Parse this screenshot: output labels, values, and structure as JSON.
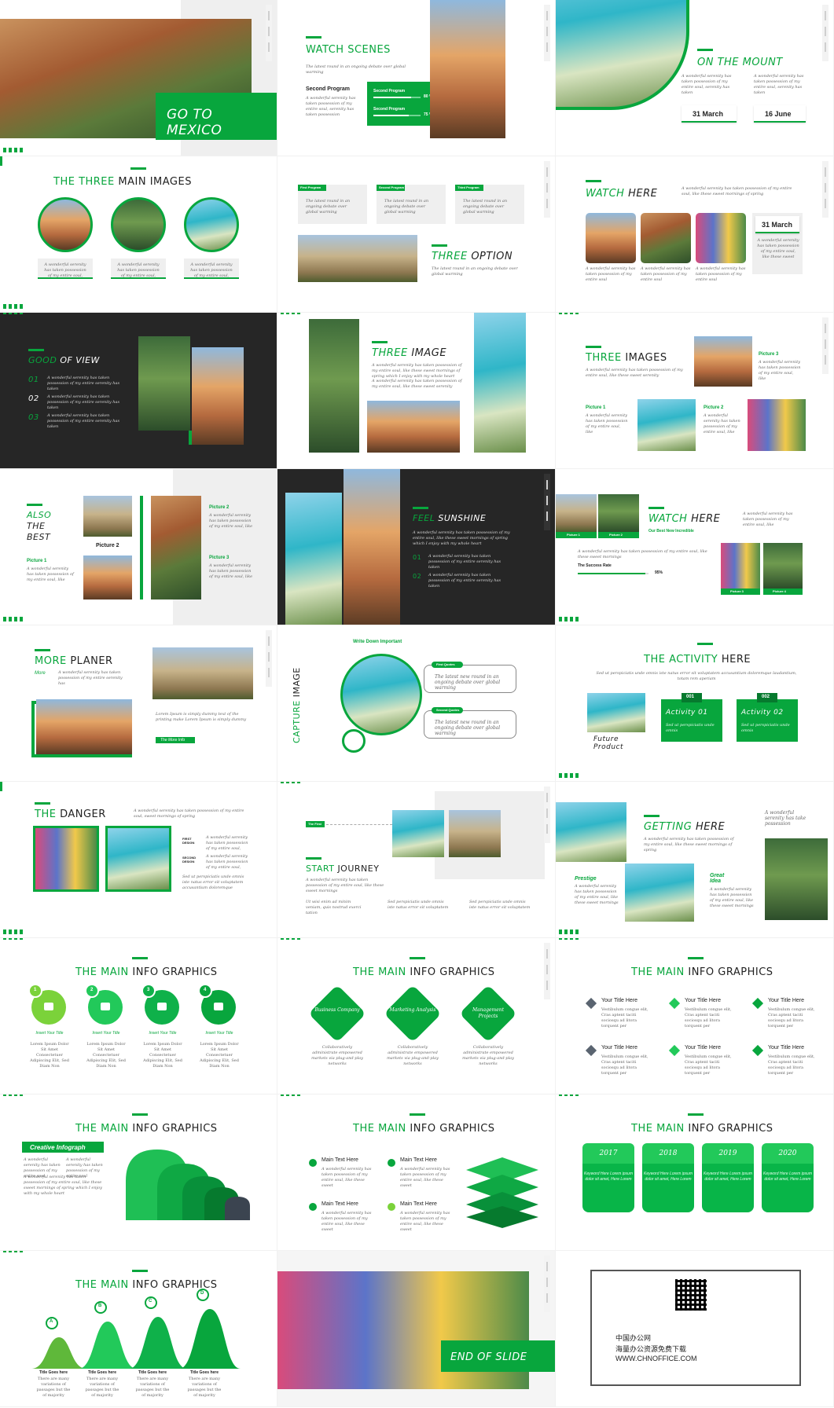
{
  "slides": {
    "s1": {
      "title": "GO TO MEXICO"
    },
    "s2": {
      "title_plain": "WATCH",
      "title_accent": "SCENES",
      "intro": "The latest round in an ongoing debate over global warming",
      "subhead": "Second Program",
      "body": "A wonderful serenity has taken possession of my entire soul, serenity has taken possession",
      "bar1_label": "Second Program",
      "bar1_value": "80 %",
      "bar1_fraction": 0.8,
      "bar2_label": "Second Program",
      "bar2_value": "75 %",
      "bar2_fraction": 0.75
    },
    "s3": {
      "title_plain": "ON THE",
      "title_accent": "MOUNT",
      "text1": "A wonderful serenity has taken possession of my entire soul, serenity has taken",
      "text2": "A wonderful serenity has taken possession of my entire soul, serenity has taken",
      "date1": "31 March",
      "date2": "16 June"
    },
    "s4": {
      "title_accent": "THE THREE",
      "title_plain": "MAIN IMAGES",
      "caption1": "A wonderful serenity has taken possession of my entire soul,",
      "caption2": "A wonderful serenity has taken possession of my entire soul,",
      "caption3": "A wonderful serenity has taken possession of my entire soul,"
    },
    "s5": {
      "tab1": "First Program",
      "tab2": "Second Program",
      "tab3": "Third Program",
      "text1": "The latest round in an ongoing debate over global warming",
      "text2": "The latest round in an ongoing debate over global warming",
      "text3": "The latest round in an ongoing debate over global warming",
      "title_accent": "THREE",
      "title_plain": "OPTION",
      "body": "The latest round in an ongoing debate over global warming"
    },
    "s6": {
      "title_accent": "WATCH",
      "title_plain": "HERE",
      "intro": "A wonderful serenity has taken possession of my entire soul, like these sweet mornings of spring",
      "date": "31 March",
      "date_text": "A wonderful serenity has taken possession of my entire soul, like these sweet",
      "cap1": "A wonderful serenity has taken possession of my entire soul",
      "cap2": "A wonderful serenity has taken possession of my entire soul",
      "cap3": "A wonderful serenity has taken possession of my entire soul"
    },
    "s7": {
      "title_accent": "GOOD",
      "title_plain": "OF VIEW",
      "n1": "01",
      "n2": "02",
      "n3": "03",
      "t1": "A wonderful serenity has taken possession of my entire serenity has taken",
      "t2": "A wonderful serenity has taken possession of my entire serenity has taken",
      "t3": "A wonderful serenity has taken possession of my entire serenity has taken"
    },
    "s8": {
      "title_accent": "THREE",
      "title_plain": "IMAGE",
      "body": "A wonderful serenity has taken possession of my entire soul, like these sweet mornings of spring which I enjoy with my whole heart",
      "body2": "A wonderful serenity has taken possession of my entire soul, like these sweet serenity"
    },
    "s9": {
      "title_accent": "THREE",
      "title_plain": "IMAGES",
      "body": "A wonderful serenity has taken possession of my entire soul, like these sweet serenity",
      "p1": "Picture 1",
      "p1_text": "A wonderful serenity has taken possession of my entire soul, like",
      "p2": "Picture 2",
      "p2_text": "A wonderful serenity has taken possession of my entire soul, like",
      "p3": "Picture 3",
      "p3_text": "A wonderful serenity has taken possession of my entire soul, like"
    },
    "s10": {
      "line1": "ALSO",
      "line2": "THE",
      "line3": "BEST",
      "p1": "Picture 1",
      "p1_text": "A wonderful serenity has taken possession of my entire soul, like",
      "p2": "Picture 2",
      "p2_center": "Picture 2",
      "p2_text": "A wonderful serenity has taken possession of my entire soul, like",
      "p3": "Picture 3",
      "p3_text": "A wonderful serenity has taken possession of my entire soul, like"
    },
    "s11": {
      "title_accent": "FEEL",
      "title_plain": "SUNSHINE",
      "body": "A wonderful serenity has taken possession of my entire soul, like these sweet mornings of spring which I enjoy with my whole heart",
      "n1": "01",
      "t1": "A wonderful serenity has taken possession of my entire serenity has taken",
      "n2": "02",
      "t2": "A wonderful serenity has taken possession of my entire serenity has taken"
    },
    "s12": {
      "title_accent": "WATCH",
      "title_plain": "HERE",
      "subtitle": "Our Best New Incredible",
      "side": "A wonderful serenity has taken possession of my entire soul, like",
      "body": "A wonderful serenity has taken possession of my entire soul, like these sweet mornings",
      "rate_label": "The Success Rate",
      "rate_value": "95%",
      "rate_fraction": 0.95,
      "pic1": "Picture 1",
      "pic2": "Picture 2",
      "pic3": "Picture 3",
      "pic4": "Picture 4"
    },
    "s13": {
      "title_accent": "MORE",
      "title_plain": "PLANER",
      "more": "More",
      "more_text": "A wonderful serenity has taken possession of my entire serenity has",
      "lorem": "Lorem Ipsum is simply dummy text of the printing make Lorem Ipsum is simply dummy",
      "button": "The More Info"
    },
    "s14": {
      "header": "Write Down Important",
      "vertical_accent": "CAPTURE",
      "vertical_plain": "IMAGE",
      "q1_label": "First Quotes",
      "q1": "The latest new round in an ongoing debate over global warming",
      "q2_label": "Second Quotes",
      "q2": "The latest new round in an ongoing debate over global warming"
    },
    "s15": {
      "title_plain": "THE",
      "title_accent": "ACTIVITY",
      "title_end": "HERE",
      "intro": "Sed ut perspiciatis unde omnis iste natus error sit voluptatem accusantium doloremque laudantium, totam rem aperiam",
      "future": "Future Product",
      "a1_num": "001",
      "a1": "Activity 01",
      "a1_text": "Sed ut perspiciatis unde omnis",
      "a2_num": "002",
      "a2": "Activity 02",
      "a2_text": "Sed ut perspiciatis unde omnis"
    },
    "s16": {
      "title_accent": "THE",
      "title_plain": "DANGER",
      "intro": "A wonderful serenity has taken possession of my entire soul, sweet mornings of spring",
      "first": "FIRST DESIGN",
      "first_text": "A wonderful serenity has taken possession of my entire soul,",
      "second": "SECOND DESIGN",
      "second_text": "A wonderful serenity has taken possession of my entire soul,",
      "bottom": "Sed ut perspiciatis unde omnis iste natus error sit voluptatem accusantium doloremque"
    },
    "s17": {
      "tag": "The First",
      "title_accent": "START",
      "title_plain": "JOURNEY",
      "body": "A wonderful serenity has taken possession of my entire soul, like these sweet mornings",
      "c1": "Ut wisi enim ad minim veniam, quis nostrud exerci tation",
      "c2": "Sed perspiciatis unde omnis iste natus error sit voluptatem",
      "c3": "Sed perspiciatis unde omnis iste natus error sit voluptatem"
    },
    "s18": {
      "title_accent": "GETTING",
      "title_plain": "HERE",
      "quote": "A wonderful serenity has take possession",
      "body": "A wonderful serenity has taken possession of my entire soul, like these sweet mornings of spring",
      "prestige": "Prestige",
      "prestige_text": "A wonderful serenity has taken possession of my entire soul, like these sweet mornings",
      "great": "Great Idea",
      "great_text": "A wonderful serenity has taken possession of my entire soul, like these sweet mornings"
    },
    "s19": {
      "title_plain": "THE MAIN",
      "title_accent": "INFO",
      "title_end": "GRAPHICS",
      "items": [
        {
          "num": "1",
          "label": "Insert Your Title",
          "text": "Lorem Ipsum Dolor Sit Amet Consectetuer Adipiscing Elit, Sed Diam Non"
        },
        {
          "num": "2",
          "label": "Insert Your Title",
          "text": "Lorem Ipsum Dolor Sit Amet Consectetuer Adipiscing Elit, Sed Diam Non"
        },
        {
          "num": "3",
          "label": "Insert Your Title",
          "text": "Lorem Ipsum Dolor Sit Amet Consectetuer Adipiscing Elit, Sed Diam Non"
        },
        {
          "num": "4",
          "label": "Insert Your Title",
          "text": "Lorem Ipsum Dolor Sit Amet Consectetuer Adipiscing Elit, Sed Diam Non"
        }
      ]
    },
    "s20": {
      "title_plain": "THE MAIN",
      "title_accent": "INFO",
      "title_end": "GRAPHICS",
      "d1": "Business Company",
      "d2": "Marketing Analysis",
      "d3": "Management Projects",
      "t1": "Collaboratively administrate empowered markets via plug-and-play networks",
      "t2": "Collaboratively administrate empowered markets via plug-and-play networks",
      "t3": "Collaboratively administrate empowered markets via plug-and-play networks"
    },
    "s21": {
      "title_plain": "THE MAIN",
      "title_accent": "INFO",
      "title_end": "GRAPHICS",
      "items": [
        {
          "t": "Your Title Here",
          "d": "Vestibulum congue elit, Cras aptent taciti sociosqu ad litora torquent per"
        },
        {
          "t": "Your Title Here",
          "d": "Vestibulum congue elit, Cras aptent taciti sociosqu ad litora torquent per"
        },
        {
          "t": "Your Title Here",
          "d": "Vestibulum congue elit, Cras aptent taciti sociosqu ad litora torquent per"
        },
        {
          "t": "Your Title Here",
          "d": "Vestibulum congue elit, Cras aptent taciti sociosqu ad litora torquent per"
        },
        {
          "t": "Your Title Here",
          "d": "Vestibulum congue elit, Cras aptent taciti sociosqu ad litora torquent per"
        },
        {
          "t": "Your Title Here",
          "d": "Vestibulum congue elit, Cras aptent taciti sociosqu ad litora torquent per"
        }
      ]
    },
    "s22": {
      "title_plain": "THE MAIN",
      "title_accent": "INFO",
      "title_end": "GRAPHICS",
      "badge": "Creative Infograph",
      "t1": "A wonderful serenity has taken possession of my entire soul",
      "t2": "A wonderful serenity has taken possession of my entire soul",
      "t3": "A wonderful serenity has taken possession of my entire soul, like these sweet mornings of spring which I enjoy with my whole heart"
    },
    "s23": {
      "title_plain": "THE MAIN",
      "title_accent": "INFO",
      "title_end": "GRAPHICS",
      "items": [
        {
          "t": "Main Text Here",
          "d": "A wonderful serenity has taken possession of my entire soul, like these sweet"
        },
        {
          "t": "Main Text Here",
          "d": "A wonderful serenity has taken possession of my entire soul, like these sweet"
        },
        {
          "t": "Main Text Here",
          "d": "A wonderful serenity has taken possession of my entire soul, like these sweet"
        },
        {
          "t": "Main Text Here",
          "d": "A wonderful serenity has taken possession of my entire soul, like these sweet"
        }
      ]
    },
    "s24": {
      "title_plain": "THE MAIN",
      "title_accent": "INFO",
      "title_end": "GRAPHICS",
      "years": [
        {
          "y": "2017",
          "d": "Keyword Here Lorem ipsum dolor sit amet, Here Lorem"
        },
        {
          "y": "2018",
          "d": "Keyword Here Lorem ipsum dolor sit amet, Here Lorem"
        },
        {
          "y": "2019",
          "d": "Keyword Here Lorem ipsum dolor sit amet, Here Lorem"
        },
        {
          "y": "2020",
          "d": "Keyword Here Lorem ipsum dolor sit amet, Here Lorem"
        }
      ]
    },
    "s25": {
      "title_plain": "THE MAIN",
      "title_accent": "INFO",
      "title_end": "GRAPHICS",
      "items": [
        {
          "letter": "A",
          "t": "Title Goes here",
          "d": "There are many variations of passages but the of majority"
        },
        {
          "letter": "B",
          "t": "Title Goes here",
          "d": "There are many variations of passages but the of majority"
        },
        {
          "letter": "C",
          "t": "Title Goes here",
          "d": "There are many variations of passages but the of majority"
        },
        {
          "letter": "D",
          "t": "Title Goes here",
          "d": "There are many variations of passages but the of majority"
        }
      ]
    },
    "s26": {
      "title": "END OF SLIDE"
    },
    "s27": {
      "line1": "中国办公网",
      "line2": "海量办公资源免费下载",
      "line3": "WWW.CHNOFFICE.COM"
    }
  },
  "colors": {
    "accent": "#08a63d",
    "dark": "#262626"
  }
}
